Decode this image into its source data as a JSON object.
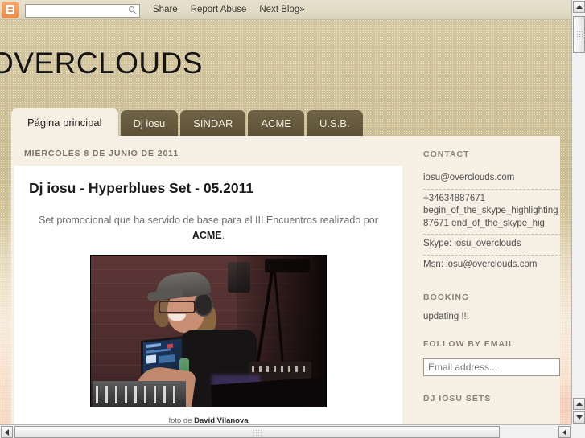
{
  "navbar": {
    "logo_icon": "blogger-b-icon",
    "search": {
      "value": "",
      "placeholder": "",
      "icon": "search-icon"
    },
    "links": [
      "Share",
      "Report Abuse",
      "Next Blog»"
    ]
  },
  "header": {
    "blog_title": "OVERCLOUDS"
  },
  "tabs": [
    {
      "label": "Página principal",
      "active": true
    },
    {
      "label": "Dj iosu",
      "active": false
    },
    {
      "label": "SINDAR",
      "active": false
    },
    {
      "label": "ACME",
      "active": false
    },
    {
      "label": "U.S.B.",
      "active": false
    }
  ],
  "post": {
    "date": "MIÉRCOLES 8 DE JUNIO DE 2011",
    "title": "Dj iosu - Hyperblues Set - 05.2011",
    "body_before": "Set promocional que ha servido de base para el III Encuentros realizado por ",
    "body_bold": "ACME",
    "body_after": ".",
    "photo_alt": "dj-photo",
    "caption_prefix": "foto de ",
    "caption_author": "David Vilanova"
  },
  "sidebar": {
    "contact": {
      "heading": "CONTACT",
      "lines": [
        "iosu@overclouds.com",
        "+34634887671",
        "begin_of_the_skype_highlighting",
        "87671      end_of_the_skype_hig",
        "Skype: iosu_overclouds",
        "Msn: iosu@overclouds.com"
      ]
    },
    "booking": {
      "heading": "BOOKING",
      "text": "updating !!!"
    },
    "follow": {
      "heading": "FOLLOW BY EMAIL",
      "input_value": "",
      "input_placeholder": "Email address..."
    },
    "sets": {
      "heading": "DJ IOSU SETS"
    }
  },
  "colors": {
    "tab_active_bg": "#f6f0e4",
    "tab_inactive_bg": "#665a3f",
    "content_bg": "#f6f0e4",
    "post_card_bg": "#ffffff",
    "brand_orange": "#ee8f4d",
    "heading_gray": "#8a8272"
  }
}
